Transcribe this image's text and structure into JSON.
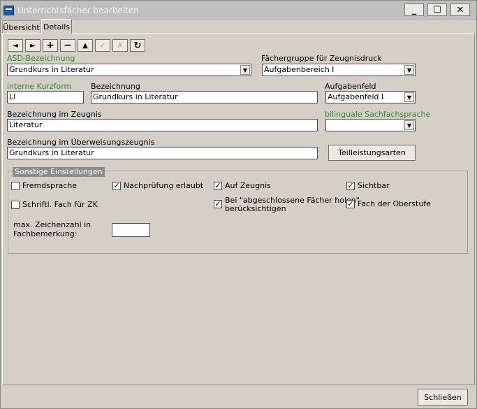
{
  "window": {
    "title": "Unterrichtsfächer bearbeiten",
    "minimize": "_",
    "maximize": "☐",
    "close": "✕"
  },
  "tabs": [
    {
      "label": "Übersicht",
      "active": false
    },
    {
      "label": "Details",
      "active": true
    }
  ],
  "toolbar": {
    "prev": "◄",
    "next": "►",
    "add": "+",
    "remove": "−",
    "up": "▲",
    "confirm": "✓",
    "cancel": "✗",
    "refresh": "↻"
  },
  "form": {
    "asd_label": "ASD-Bezeichnung",
    "asd_value": "Grundkurs in Literatur",
    "faechergruppe_label": "Fächergruppe für Zeugnisdruck",
    "faechergruppe_value": "Aufgabenbereich I",
    "kurzform_label": "interne Kurzform",
    "kurzform_value": "LI",
    "bezeichnung_label": "Bezeichnung",
    "bezeichnung_value": "Grundkurs in Literatur",
    "aufgabenfeld_label": "Aufgabenfeld",
    "aufgabenfeld_value": "Aufgabenfeld I",
    "zeugnis_label": "Bezeichnung im Zeugnis",
    "zeugnis_value": "Literatur",
    "bilingual_label": "bilinguale Sachfachsprache",
    "bilingual_value": "",
    "ueberweisung_label": "Bezeichnung im Überweisungszeugnis",
    "ueberweisung_value": "Grundkurs in Literatur",
    "teilleistung_button": "Teilleistungsarten"
  },
  "settings": {
    "title": "Sonstige Einstellungen",
    "fremdsprache": {
      "label": "Fremdsprache",
      "checked": false
    },
    "nachpruefung": {
      "label": "Nachprüfung erlaubt",
      "checked": true
    },
    "auf_zeugnis": {
      "label": "Auf Zeugnis",
      "checked": true
    },
    "sichtbar": {
      "label": "Sichtbar",
      "checked": true
    },
    "schriftl": {
      "label": "Schriftl. Fach für ZK",
      "checked": false
    },
    "abgeschlossen": {
      "label_line1": "Bei \"abgeschlossene Fächer holen\"",
      "label_line2": "berücksichtigen",
      "checked": true
    },
    "oberstufe": {
      "label": "Fach der Oberstufe",
      "checked": true
    },
    "max_zeichen_line1": "max. Zeichenzahl in",
    "max_zeichen_line2": "Fachbemerkung:",
    "max_zeichen_value": ""
  },
  "footer": {
    "close_button": "Schließen"
  },
  "colors": {
    "green_label": "#2a8a2a",
    "background": "#d4d0c8"
  }
}
